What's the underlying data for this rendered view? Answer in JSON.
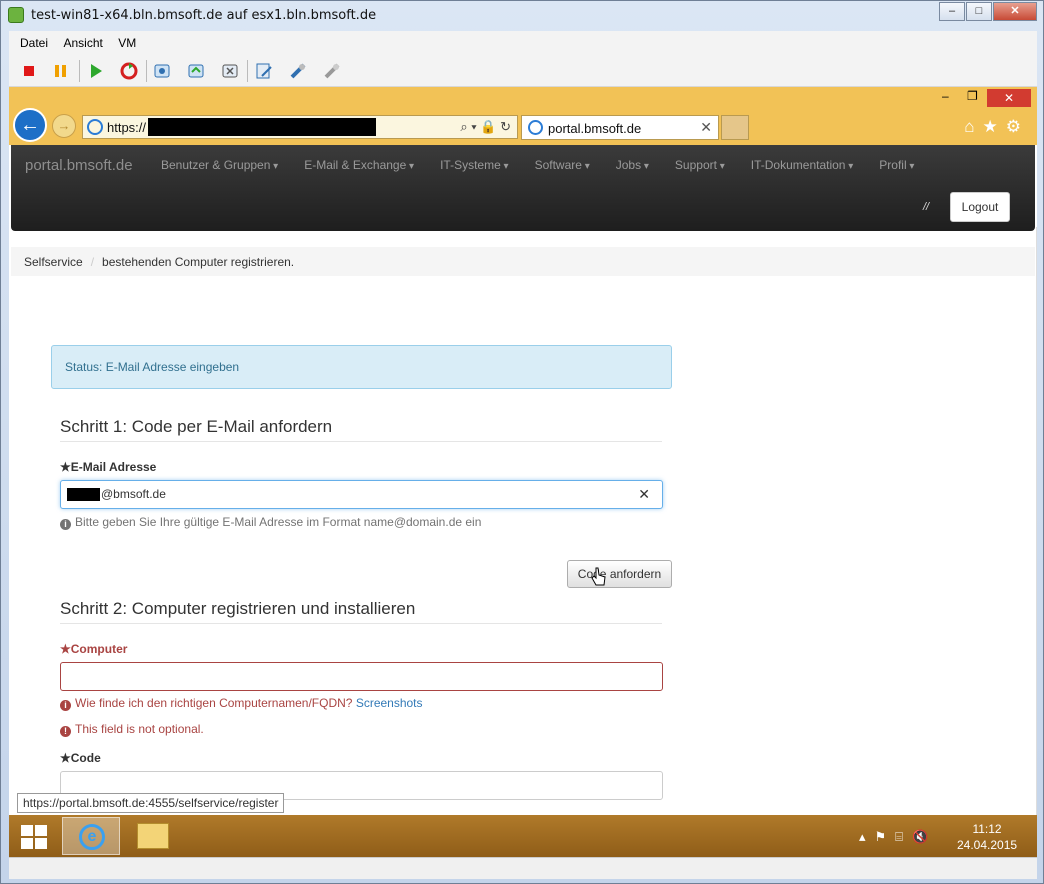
{
  "window": {
    "title": "test-win81-x64.bln.bmsoft.de auf esx1.bln.bmsoft.de",
    "minimize": "–",
    "restore": "□",
    "close": "✕"
  },
  "menu": [
    "Datei",
    "Ansicht",
    "VM"
  ],
  "toolbar_icons": [
    "stop-icon",
    "pause-icon",
    "play-icon",
    "reset-icon",
    "snapshot-icon",
    "snapshot-revert-icon",
    "snapshot-manager-icon",
    "edit-settings-icon",
    "connect-device-icon",
    "disconnect-device-icon"
  ],
  "ie": {
    "url_prefix": "https://",
    "tab_title": "portal.bmsoft.de",
    "min": "–",
    "restore": "❐",
    "close": "✕",
    "addr_tools": "⌕ ▾ 🔒 ↻",
    "right_icons": "⌂★⚙"
  },
  "navbar": {
    "brand": "portal.bmsoft.de",
    "items": [
      "Benutzer & Gruppen",
      "E-Mail & Exchange",
      "IT-Systeme",
      "Software",
      "Jobs",
      "Support",
      "IT-Dokumentation",
      "Profil"
    ],
    "slash": "//",
    "logout": "Logout"
  },
  "breadcrumb": {
    "home": "Selfservice",
    "sep": "/",
    "current": "bestehenden Computer registrieren."
  },
  "status_alert": "Status: E-Mail Adresse eingeben",
  "step1": {
    "heading": "Schritt 1: Code per E-Mail anfordern",
    "email_label": "★E-Mail Adresse",
    "email_value": "@bmsoft.de",
    "clear": "✕",
    "help": "Bitte geben Sie Ihre gültige E-Mail Adresse im Format name@domain.de ein",
    "button": "Code anfordern"
  },
  "step2": {
    "heading": "Schritt 2: Computer registrieren und installieren",
    "computer_label": "★Computer",
    "computer_help": "Wie finde ich den richtigen Computernamen/FQDN?",
    "computer_link": "Screenshots",
    "computer_error": "This field is not optional.",
    "code_label": "★Code"
  },
  "status_url": "https://portal.bmsoft.de:4555/selfservice/register",
  "taskbar": {
    "time": "11:12",
    "date": "24.04.2015",
    "tray": "▴⚑⌸🔇"
  },
  "colors": {
    "navbar": "#2b2b2b",
    "ie_frame": "#f2c256",
    "taskbar": "#a06c22",
    "alert_bg": "#d9edf7",
    "error": "#a94442"
  }
}
